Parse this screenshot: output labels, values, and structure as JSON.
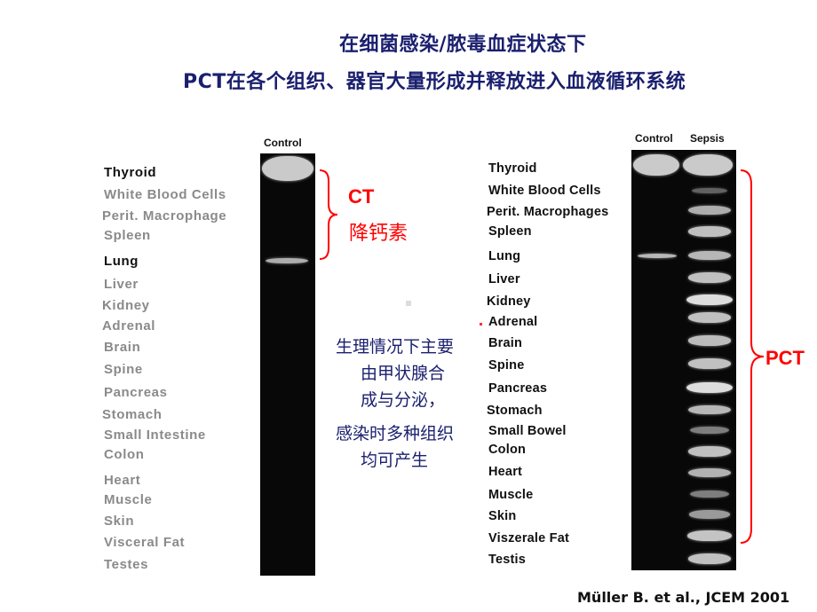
{
  "title": {
    "line1": "在细菌感染/脓毒血症状态下",
    "line2": "PCT在各个组织、器官大量形成并释放进入血液循环系统"
  },
  "left_gel": {
    "lane_headers": [
      "Control"
    ],
    "tissues": [
      {
        "name": "Thyroid",
        "emphasis": true
      },
      {
        "name": "White Blood Cells",
        "emphasis": false
      },
      {
        "name": "Perit. Macrophage",
        "emphasis": false
      },
      {
        "name": "Spleen",
        "emphasis": false
      },
      {
        "name": "Lung",
        "emphasis": true
      },
      {
        "name": "Liver",
        "emphasis": false
      },
      {
        "name": "Kidney",
        "emphasis": false
      },
      {
        "name": "Adrenal",
        "emphasis": false
      },
      {
        "name": "Brain",
        "emphasis": false
      },
      {
        "name": "Spine",
        "emphasis": false
      },
      {
        "name": "Pancreas",
        "emphasis": false
      },
      {
        "name": "Stomach",
        "emphasis": false
      },
      {
        "name": "Small Intestine",
        "emphasis": false
      },
      {
        "name": "Colon",
        "emphasis": false
      },
      {
        "name": "Heart",
        "emphasis": false
      },
      {
        "name": "Muscle",
        "emphasis": false
      },
      {
        "name": "Skin",
        "emphasis": false
      },
      {
        "name": "Visceral Fat",
        "emphasis": false
      },
      {
        "name": "Testes",
        "emphasis": false
      }
    ],
    "control_bands": [
      {
        "tissue": "Thyroid",
        "intensity": 0.85
      },
      {
        "tissue": "Lung",
        "intensity": 0.7
      }
    ]
  },
  "right_gel": {
    "lane_headers": [
      "Control",
      "Sepsis"
    ],
    "tissues": [
      "Thyroid",
      "White Blood Cells",
      "Perit. Macrophages",
      "Spleen",
      "Lung",
      "Liver",
      "Kidney",
      "Adrenal",
      "Brain",
      "Spine",
      "Pancreas",
      "Stomach",
      "Small Bowel",
      "Colon",
      "Heart",
      "Muscle",
      "Skin",
      "Viszerale Fat",
      "Testis"
    ],
    "control_bands": [
      {
        "tissue": "Thyroid",
        "intensity": 0.85
      },
      {
        "tissue": "Lung",
        "intensity": 0.75
      }
    ],
    "sepsis_bands": [
      {
        "tissue": "Thyroid",
        "intensity": 0.85
      },
      {
        "tissue": "White Blood Cells",
        "intensity": 0.3
      },
      {
        "tissue": "Perit. Macrophages",
        "intensity": 0.7
      },
      {
        "tissue": "Spleen",
        "intensity": 0.8
      },
      {
        "tissue": "Lung",
        "intensity": 0.75
      },
      {
        "tissue": "Liver",
        "intensity": 0.8
      },
      {
        "tissue": "Kidney",
        "intensity": 0.95
      },
      {
        "tissue": "Adrenal",
        "intensity": 0.8
      },
      {
        "tissue": "Brain",
        "intensity": 0.78
      },
      {
        "tissue": "Spine",
        "intensity": 0.8
      },
      {
        "tissue": "Pancreas",
        "intensity": 0.95
      },
      {
        "tissue": "Stomach",
        "intensity": 0.75
      },
      {
        "tissue": "Small Bowel",
        "intensity": 0.45
      },
      {
        "tissue": "Colon",
        "intensity": 0.8
      },
      {
        "tissue": "Heart",
        "intensity": 0.72
      },
      {
        "tissue": "Muscle",
        "intensity": 0.45
      },
      {
        "tissue": "Skin",
        "intensity": 0.6
      },
      {
        "tissue": "Viszerale Fat",
        "intensity": 0.82
      },
      {
        "tissue": "Testis",
        "intensity": 0.8
      }
    ]
  },
  "annotations": {
    "ct_abbrev": "CT",
    "ct_chinese": "降钙素",
    "pct_abbrev": "PCT",
    "note_lines": [
      "生理情况下主要",
      "由甲状腺合",
      "成与分泌，",
      "感染时多种组织",
      "均可产生"
    ]
  },
  "citation": "Müller B. et al., JCEM 2001",
  "colors": {
    "title": "#1a1f6e",
    "annotation_red": "#ff0000",
    "gel_background": "#080808",
    "faded_label": "#8a8a8a"
  }
}
